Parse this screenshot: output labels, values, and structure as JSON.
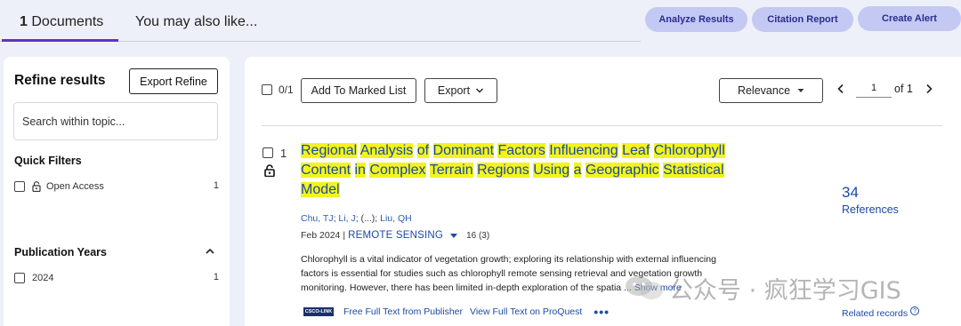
{
  "tabs": {
    "documents_count": "1",
    "documents_label": "Documents",
    "also_like": "You may also like..."
  },
  "actions": {
    "analyze": "Analyze Results",
    "citation": "Citation Report",
    "alert": "Create Alert"
  },
  "sidebar": {
    "title": "Refine results",
    "export_refine": "Export Refine",
    "search_placeholder": "Search within topic...",
    "quick_filters_title": "Quick Filters",
    "quick_filters": [
      {
        "label": "Open Access",
        "count": "1"
      }
    ],
    "publication_years_title": "Publication Years",
    "years": [
      {
        "label": "2024",
        "count": "1"
      }
    ]
  },
  "toolbar": {
    "selected": "0/1",
    "add_marked": "Add To Marked List",
    "export": "Export",
    "sort": "Relevance",
    "page": "1",
    "of_pages": "of 1"
  },
  "record": {
    "number": "1",
    "title_words": [
      "Regional",
      "Analysis",
      "of",
      "Dominant",
      "Factors",
      "Influencing",
      "Leaf",
      "Chlorophyll",
      "Content",
      "in",
      "Complex",
      "Terrain",
      "Regions",
      "Using",
      "a",
      "Geographic",
      "Statistical",
      "Model"
    ],
    "authors": [
      {
        "text": "Chu, TJ",
        "link": true
      },
      {
        "text": "; ",
        "link": false
      },
      {
        "text": "Li, J",
        "link": true
      },
      {
        "text": "; (...); ",
        "link": false
      },
      {
        "text": "Liu, QH",
        "link": true
      }
    ],
    "date": "Feb 2024",
    "separator": "|",
    "journal": "REMOTE SENSING",
    "cites": "16 (3)",
    "abstract": "Chlorophyll is a vital indicator of vegetation growth; exploring its relationship with external influencing factors is essential for studies such as chlorophyll remote sensing retrieval and vegetation growth monitoring. However, there has been limited in-depth exploration of the spatia ...",
    "show_more": "Show more",
    "link_badge": "CSCO-LINK",
    "free_full_text": "Free Full Text from Publisher",
    "proquest": "View Full Text on ProQuest",
    "more_dots": "•••",
    "references_count": "34",
    "references_label": "References",
    "related": "Related records",
    "help": "?"
  },
  "watermark": {
    "text": "公众号 · 疯狂学习GIS"
  }
}
